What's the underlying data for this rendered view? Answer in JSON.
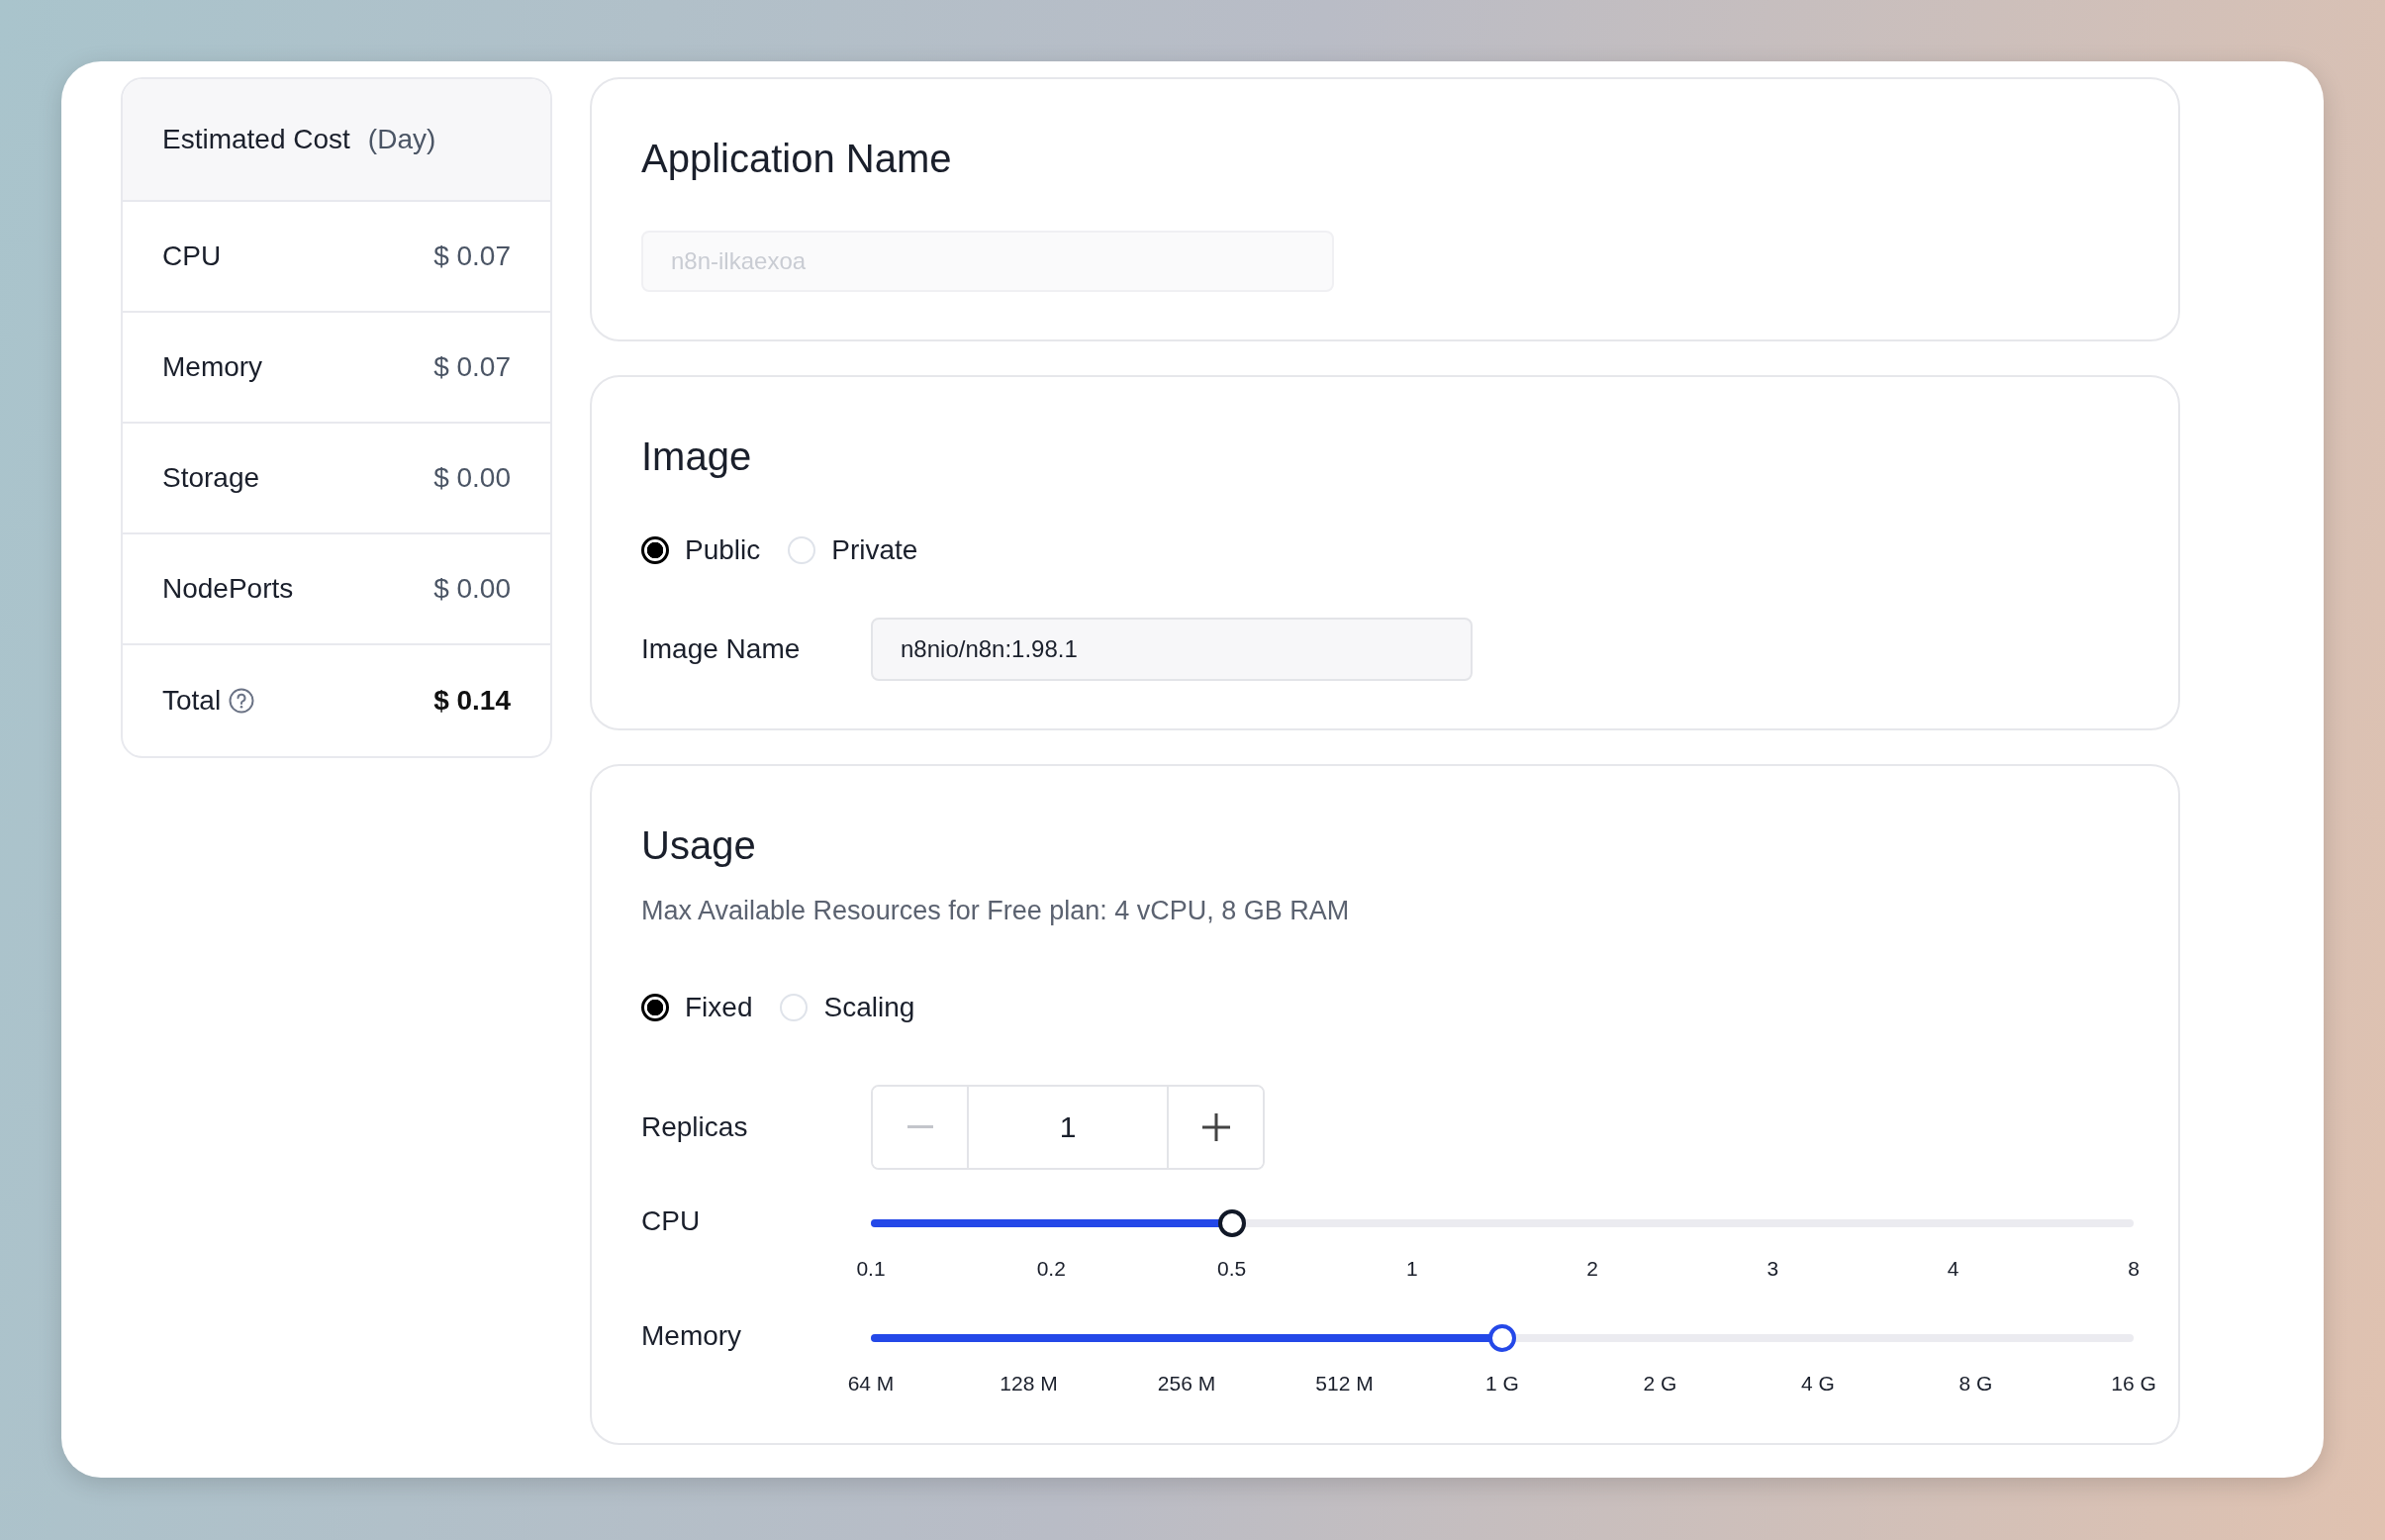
{
  "cost": {
    "title": "Estimated Cost",
    "period": "(Day)",
    "rows": [
      {
        "label": "CPU",
        "value": "$ 0.07"
      },
      {
        "label": "Memory",
        "value": "$ 0.07"
      },
      {
        "label": "Storage",
        "value": "$ 0.00"
      },
      {
        "label": "NodePorts",
        "value": "$ 0.00"
      }
    ],
    "total": {
      "label": "Total",
      "value": "$ 0.14"
    }
  },
  "app_name": {
    "title": "Application Name",
    "placeholder": "n8n-ilkaexoa"
  },
  "image": {
    "title": "Image",
    "options": [
      {
        "label": "Public",
        "selected": true
      },
      {
        "label": "Private",
        "selected": false
      }
    ],
    "name_label": "Image Name",
    "name_value": "n8nio/n8n:1.98.1"
  },
  "usage": {
    "title": "Usage",
    "note": "Max Available Resources for Free plan: 4 vCPU, 8 GB RAM",
    "modes": [
      {
        "label": "Fixed",
        "selected": true
      },
      {
        "label": "Scaling",
        "selected": false
      }
    ],
    "replicas": {
      "label": "Replicas",
      "value": "1",
      "decrement_disabled": true
    },
    "sliders": [
      {
        "label": "CPU",
        "level": 0.2857,
        "focused": true,
        "ticks": [
          "0.1",
          "0.2",
          "0.5",
          "1",
          "2",
          "3",
          "4",
          "8"
        ]
      },
      {
        "label": "Memory",
        "level": 0.5,
        "focused": false,
        "ticks": [
          "64 M",
          "128 M",
          "256 M",
          "512 M",
          "1 G",
          "2 G",
          "4 G",
          "8 G",
          "16 G"
        ]
      }
    ]
  }
}
